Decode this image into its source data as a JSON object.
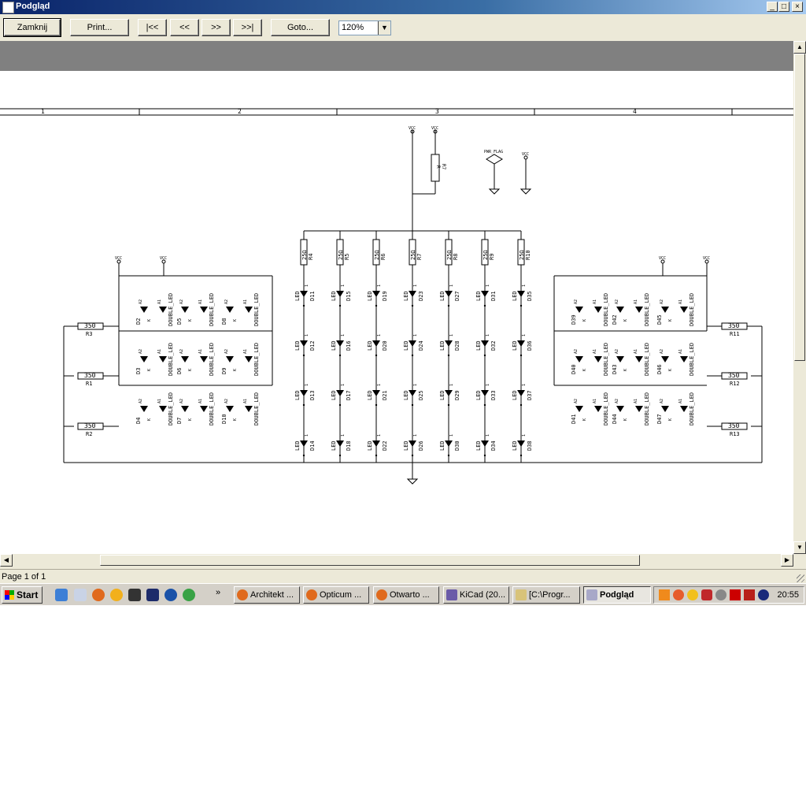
{
  "window": {
    "title": "Podgląd",
    "controls": {
      "minimize": "_",
      "maximize": "□",
      "close": "×"
    }
  },
  "toolbar": {
    "close_label": "Zamknij",
    "print_label": "Print...",
    "first_label": "|<<",
    "prev_label": "<<",
    "next_label": ">>",
    "last_label": ">>|",
    "goto_label": "Goto...",
    "zoom_value": "120%"
  },
  "status": {
    "page_text": "Page 1 of 1"
  },
  "schematic": {
    "frame_columns": [
      "1",
      "2",
      "3",
      "4"
    ],
    "top_labels": {
      "vcc_a": "VCC",
      "vcc_b": "VCC",
      "vcc_c": "VCC",
      "pwr_flag": "PWR_FLAG",
      "r_top": "R",
      "r_top_ref": "R7"
    },
    "resistors_top": [
      {
        "value": "25Ω",
        "ref": "R4"
      },
      {
        "value": "25Ω",
        "ref": "R5"
      },
      {
        "value": "25Ω",
        "ref": "R6"
      },
      {
        "value": "25Ω",
        "ref": "R7"
      },
      {
        "value": "25Ω",
        "ref": "R8"
      },
      {
        "value": "25Ω",
        "ref": "R9"
      },
      {
        "value": "25Ω",
        "ref": "R10"
      }
    ],
    "led_columns": [
      [
        "D11",
        "D12",
        "D13",
        "D14"
      ],
      [
        "D15",
        "D16",
        "D17",
        "D18"
      ],
      [
        "D19",
        "D20",
        "D21",
        "D22"
      ],
      [
        "D23",
        "D24",
        "D25",
        "D26"
      ],
      [
        "D27",
        "D28",
        "D29",
        "D30"
      ],
      [
        "D31",
        "D32",
        "D33",
        "D34"
      ],
      [
        "D35",
        "D36",
        "D37",
        "D38"
      ]
    ],
    "led_label": "LED",
    "pin_label": "1",
    "left_resistors": [
      {
        "value": "350",
        "ref": "R3"
      },
      {
        "value": "350",
        "ref": "R1"
      },
      {
        "value": "350",
        "ref": "R2"
      }
    ],
    "right_resistors": [
      {
        "value": "350",
        "ref": "R11"
      },
      {
        "value": "350",
        "ref": "R12"
      },
      {
        "value": "350",
        "ref": "R13"
      }
    ],
    "left_double_leds": [
      [
        "D2",
        "D5",
        "D8"
      ],
      [
        "D3",
        "D6",
        "D9"
      ],
      [
        "D4",
        "D7",
        "D10"
      ]
    ],
    "right_double_leds": [
      [
        "D39",
        "D42",
        "D45"
      ],
      [
        "D40",
        "D43",
        "D46"
      ],
      [
        "D41",
        "D44",
        "D47"
      ]
    ],
    "double_led_label": "DOUBLE_LED",
    "pin_a1": "A1",
    "pin_a2": "A2",
    "pin_k": "K",
    "left_vcc_labels": [
      "VCC",
      "VCC"
    ],
    "right_vcc_labels": [
      "VCC",
      "VCC"
    ]
  },
  "taskbar": {
    "start_label": "Start",
    "tasks": [
      {
        "label": "Architekt ..."
      },
      {
        "label": "Opticum ..."
      },
      {
        "label": "Otwarto ..."
      },
      {
        "label": "KiCad (20..."
      },
      {
        "label": "[C:\\Progr..."
      },
      {
        "label": "Podgląd"
      }
    ],
    "overflow": "»",
    "clock": "20:55"
  },
  "colors": {
    "titlebar": "#0a246a",
    "face": "#ece9d8",
    "canvas_band": "#808080"
  }
}
